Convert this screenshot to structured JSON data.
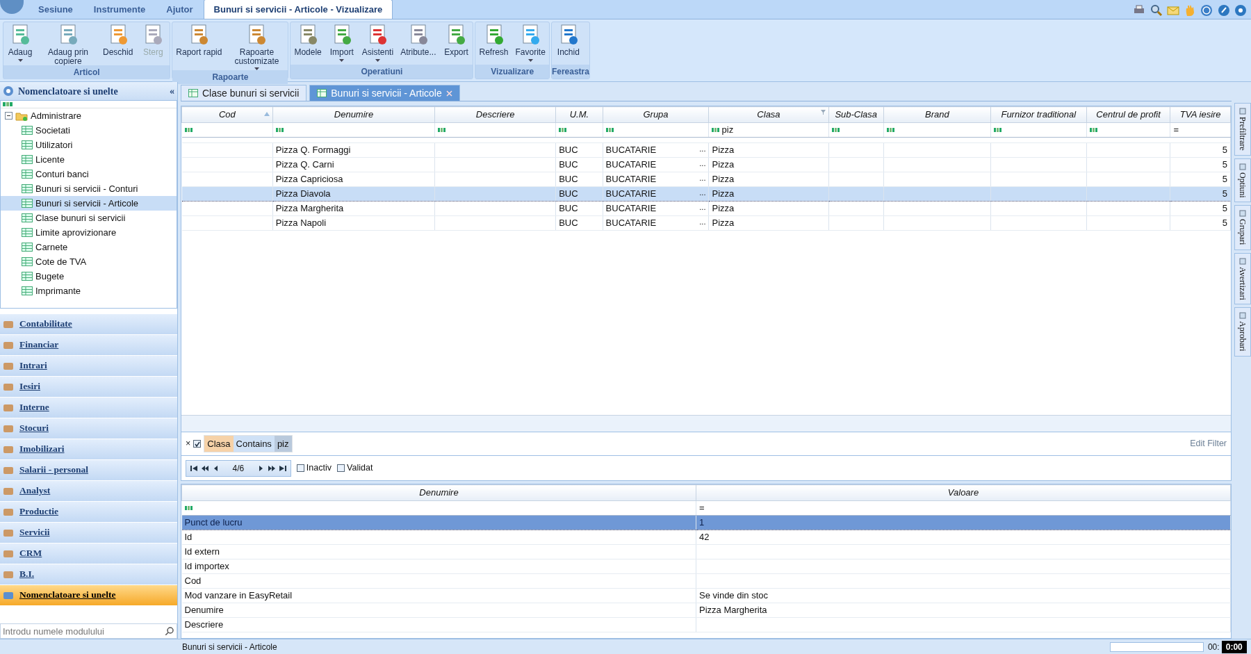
{
  "menu_tabs": [
    {
      "label": "Sesiune",
      "selected": false
    },
    {
      "label": "Instrumente",
      "selected": false
    },
    {
      "label": "Ajutor",
      "selected": false
    },
    {
      "label": "Bunuri si servicii - Articole - Vizualizare",
      "selected": true
    }
  ],
  "ribbon": [
    {
      "title": "Articol",
      "buttons": [
        {
          "label": "Adaug",
          "dropdown": true,
          "disabled": false
        },
        {
          "label": "Adaug prin copiere",
          "dropdown": false,
          "disabled": false
        },
        {
          "label": "Deschid",
          "dropdown": false,
          "disabled": false
        },
        {
          "label": "Sterg",
          "dropdown": false,
          "disabled": true
        }
      ]
    },
    {
      "title": "Rapoarte",
      "buttons": [
        {
          "label": "Raport rapid",
          "dropdown": false,
          "disabled": false
        },
        {
          "label": "Rapoarte customizate",
          "dropdown": true,
          "disabled": false
        }
      ]
    },
    {
      "title": "Operatiuni",
      "buttons": [
        {
          "label": "Modele",
          "dropdown": false,
          "disabled": false
        },
        {
          "label": "Import",
          "dropdown": true,
          "disabled": false
        },
        {
          "label": "Asistenti",
          "dropdown": true,
          "disabled": false
        },
        {
          "label": "Atribute...",
          "dropdown": false,
          "disabled": false
        },
        {
          "label": "Export",
          "dropdown": false,
          "disabled": false
        }
      ]
    },
    {
      "title": "Vizualizare",
      "buttons": [
        {
          "label": "Refresh",
          "dropdown": false,
          "disabled": false
        },
        {
          "label": "Favorite",
          "dropdown": true,
          "disabled": false
        }
      ]
    },
    {
      "title": "Fereastra",
      "buttons": [
        {
          "label": "Inchid",
          "dropdown": false,
          "disabled": false
        }
      ]
    }
  ],
  "sidebar": {
    "title": "Nomenclatoare si unelte",
    "collapse": "«",
    "tree": [
      {
        "label": "Administrare",
        "expanded": true,
        "selected": false,
        "children": [
          {
            "label": "Societati",
            "selected": false
          },
          {
            "label": "Utilizatori",
            "selected": false
          },
          {
            "label": "Licente",
            "selected": false
          },
          {
            "label": "Conturi banci",
            "selected": false
          },
          {
            "label": "Bunuri si servicii - Conturi",
            "selected": false
          },
          {
            "label": "Bunuri si servicii - Articole",
            "selected": true
          },
          {
            "label": "Clase bunuri si servicii",
            "selected": false
          },
          {
            "label": "Limite aprovizionare",
            "selected": false
          },
          {
            "label": "Carnete",
            "selected": false
          },
          {
            "label": "Cote de TVA",
            "selected": false
          },
          {
            "label": "Bugete",
            "selected": false
          },
          {
            "label": "Imprimante",
            "selected": false
          }
        ]
      }
    ],
    "modules": [
      {
        "label": "Contabilitate",
        "selected": false
      },
      {
        "label": "Financiar",
        "selected": false
      },
      {
        "label": "Intrari",
        "selected": false
      },
      {
        "label": "Iesiri",
        "selected": false
      },
      {
        "label": "Interne",
        "selected": false
      },
      {
        "label": "Stocuri",
        "selected": false
      },
      {
        "label": "Imobilizari",
        "selected": false
      },
      {
        "label": "Salarii - personal",
        "selected": false
      },
      {
        "label": "Analyst",
        "selected": false
      },
      {
        "label": "Productie",
        "selected": false
      },
      {
        "label": "Servicii",
        "selected": false
      },
      {
        "label": "CRM",
        "selected": false
      },
      {
        "label": "B.I.",
        "selected": false
      },
      {
        "label": "Nomenclatoare si unelte",
        "selected": true
      }
    ],
    "search": {
      "placeholder": "Introdu numele modulului"
    }
  },
  "doc_tabs": [
    {
      "label": "Clase bunuri si servicii",
      "selected": false,
      "closable": false
    },
    {
      "label": "Bunuri si servicii - Articole",
      "selected": true,
      "closable": true
    }
  ],
  "grid": {
    "columns": [
      {
        "label": "Cod",
        "sorted": true,
        "filtered": false
      },
      {
        "label": "Denumire",
        "sorted": false,
        "filtered": false
      },
      {
        "label": "Descriere",
        "sorted": false,
        "filtered": false
      },
      {
        "label": "U.M.",
        "sorted": false,
        "filtered": false
      },
      {
        "label": "Grupa",
        "sorted": false,
        "filtered": false
      },
      {
        "label": "Clasa",
        "sorted": false,
        "filtered": true,
        "filter": "piz"
      },
      {
        "label": "Sub-Clasa",
        "sorted": false,
        "filtered": false
      },
      {
        "label": "Brand",
        "sorted": false,
        "filtered": false
      },
      {
        "label": "Furnizor traditional",
        "sorted": false,
        "filtered": false
      },
      {
        "label": "Centrul de profit",
        "sorted": false,
        "filtered": false
      },
      {
        "label": "TVA iesire",
        "sorted": false,
        "filtered": false,
        "filter": "="
      }
    ],
    "rows": [
      {
        "selected": false,
        "cells": [
          "",
          "Pizza Q. Formaggi",
          "",
          "BUC",
          "BUCATARIE",
          "Pizza",
          "",
          "",
          "",
          "",
          "5"
        ]
      },
      {
        "selected": false,
        "cells": [
          "",
          "Pizza Q. Carni",
          "",
          "BUC",
          "BUCATARIE",
          "Pizza",
          "",
          "",
          "",
          "",
          "5"
        ]
      },
      {
        "selected": false,
        "cells": [
          "",
          "Pizza Capriciosa",
          "",
          "BUC",
          "BUCATARIE",
          "Pizza",
          "",
          "",
          "",
          "",
          "5"
        ]
      },
      {
        "selected": true,
        "cells": [
          "",
          "Pizza Diavola",
          "",
          "BUC",
          "BUCATARIE",
          "Pizza",
          "",
          "",
          "",
          "",
          "5"
        ]
      },
      {
        "selected": false,
        "cells": [
          "",
          "Pizza Margherita",
          "",
          "BUC",
          "BUCATARIE",
          "Pizza",
          "",
          "",
          "",
          "",
          "5"
        ]
      },
      {
        "selected": false,
        "cells": [
          "",
          "Pizza Napoli",
          "",
          "BUC",
          "BUCATARIE",
          "Pizza",
          "",
          "",
          "",
          "",
          "5"
        ]
      }
    ],
    "ellipsis": "..."
  },
  "filter_bar": {
    "close": "×",
    "enabled": true,
    "tokens": [
      {
        "kind": "field",
        "text": "Clasa"
      },
      {
        "kind": "operator",
        "text": "Contains"
      },
      {
        "kind": "value",
        "text": "piz"
      }
    ],
    "edit": "Edit Filter"
  },
  "navigator": {
    "position": "4/6",
    "checks": [
      {
        "label": "Inactiv",
        "checked": false
      },
      {
        "label": "Validat",
        "checked": false
      }
    ]
  },
  "properties": {
    "columns": [
      "Denumire",
      "Valoare"
    ],
    "filter": "=",
    "rows": [
      {
        "name": "Punct de lucru",
        "value": "1",
        "selected": true
      },
      {
        "name": "Id",
        "value": "42",
        "selected": false
      },
      {
        "name": "Id extern",
        "value": "",
        "selected": false
      },
      {
        "name": "Id importex",
        "value": "",
        "selected": false
      },
      {
        "name": "Cod",
        "value": "",
        "selected": false
      },
      {
        "name": "Mod vanzare in EasyRetail",
        "value": "Se vinde din stoc",
        "selected": false
      },
      {
        "name": "Denumire",
        "value": "Pizza Margherita",
        "selected": false
      },
      {
        "name": "Descriere",
        "value": "",
        "selected": false
      }
    ]
  },
  "side_tabs": [
    "Prefiltrare",
    "Optiuni",
    "Grupari",
    "Avertizari",
    "Aprobari"
  ],
  "status_bar": {
    "text": "Bunuri si servicii - Articole",
    "clock": "00:",
    "timer": "0:00"
  }
}
